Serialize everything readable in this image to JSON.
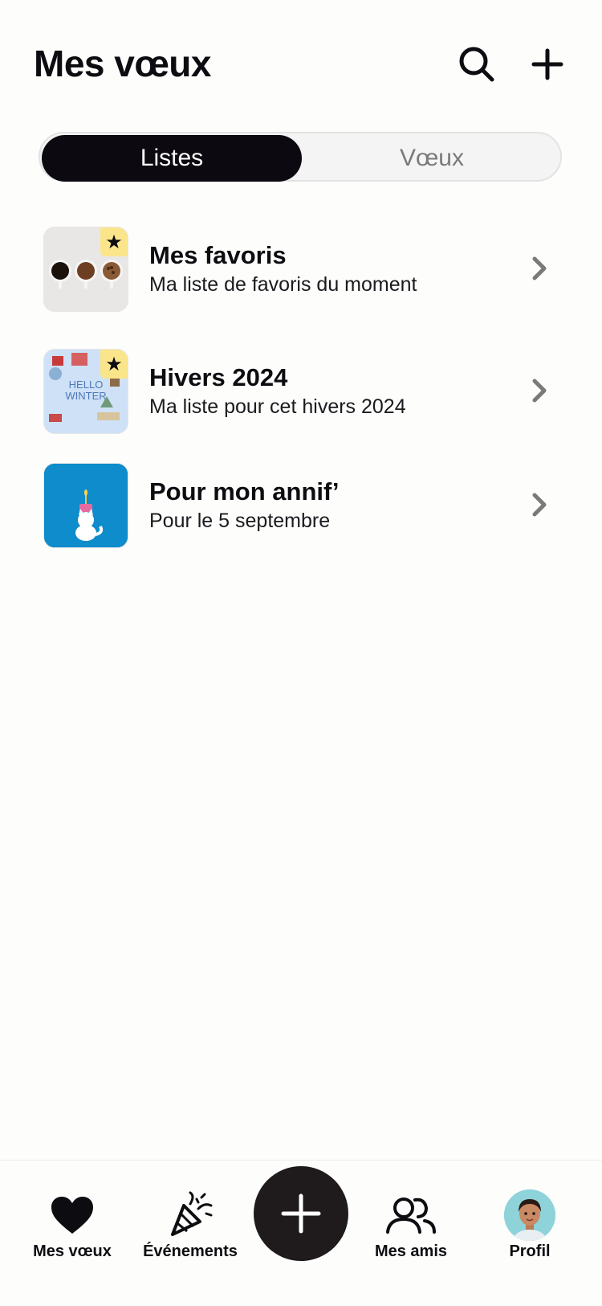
{
  "header": {
    "title": "Mes vœux",
    "search_icon": "search-icon",
    "add_icon": "plus-icon"
  },
  "segmented": {
    "tabs": [
      {
        "label": "Listes",
        "active": true
      },
      {
        "label": "Vœux",
        "active": false
      }
    ]
  },
  "lists": [
    {
      "title": "Mes favoris",
      "subtitle": "Ma liste de favoris du moment",
      "favorite": true,
      "thumbnail": "coffee-cups"
    },
    {
      "title": "Hivers 2024",
      "subtitle": "Ma liste pour cet hivers 2024",
      "favorite": true,
      "thumbnail": "hello-winter",
      "thumbnail_text": [
        "HELLO",
        "WINTER"
      ]
    },
    {
      "title": "Pour mon annif’",
      "subtitle": "Pour le 5 septembre",
      "favorite": false,
      "thumbnail": "birthday-cat"
    }
  ],
  "tabbar": {
    "items": [
      {
        "label": "Mes vœux",
        "icon": "heart-icon"
      },
      {
        "label": "Événements",
        "icon": "party-popper-icon"
      },
      {
        "label": "",
        "icon": "plus-icon"
      },
      {
        "label": "Mes amis",
        "icon": "friends-icon"
      },
      {
        "label": "Profil",
        "icon": "avatar"
      }
    ]
  },
  "colors": {
    "background": "#fdfdfc",
    "primary": "#0c0a10",
    "badge": "#fbe58a",
    "fab": "#1f1b1c"
  }
}
